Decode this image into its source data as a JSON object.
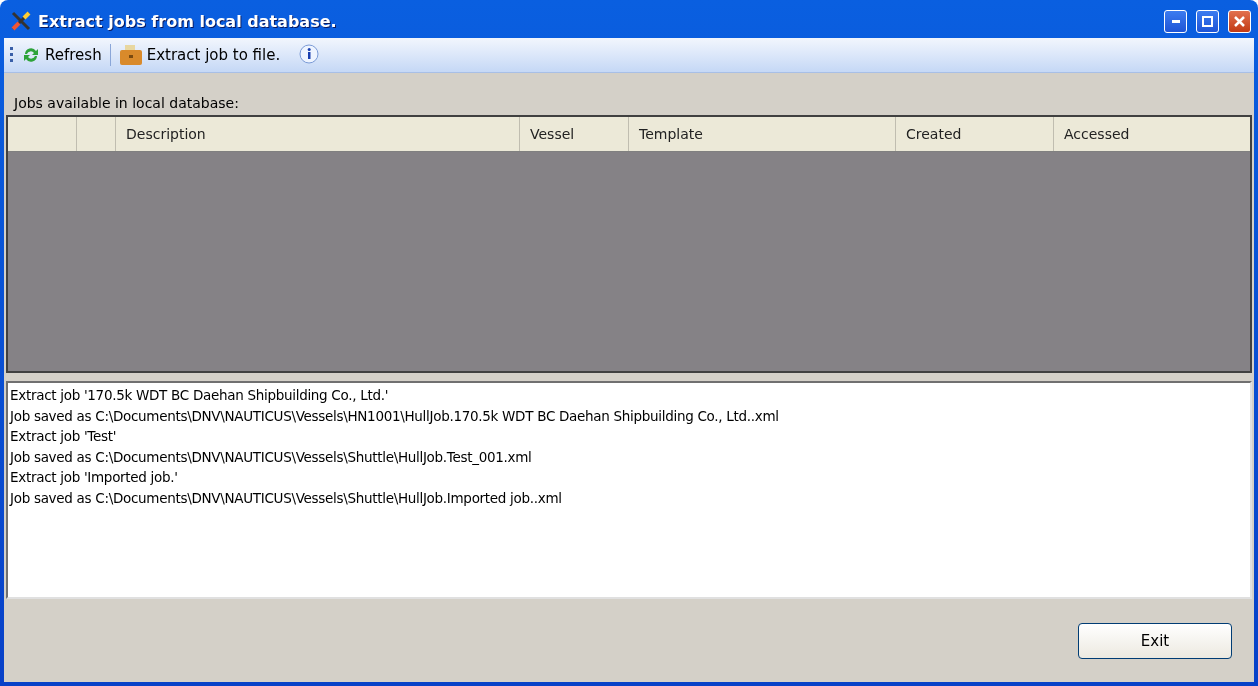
{
  "window": {
    "title": "Extract jobs from local database."
  },
  "toolbar": [
    {
      "kind": "refresh",
      "label": "Refresh"
    },
    {
      "kind": "extract",
      "label": "Extract job to file."
    },
    {
      "kind": "info"
    }
  ],
  "jobs_label": "Jobs available in local database:",
  "table": {
    "columns": [
      "Description",
      "Vessel",
      "Template",
      "Created",
      "Accessed"
    ]
  },
  "log": [
    "Extract job '170.5k WDT BC Daehan Shipbuilding Co., Ltd.'",
    "Job saved as C:\\Documents\\DNV\\NAUTICUS\\Vessels\\HN1001\\HullJob.170.5k WDT BC Daehan Shipbuilding Co., Ltd..xml",
    "Extract job 'Test'",
    "Job saved as C:\\Documents\\DNV\\NAUTICUS\\Vessels\\Shuttle\\HullJob.Test_001.xml",
    "Extract job 'Imported job.'",
    "Job saved as C:\\Documents\\DNV\\NAUTICUS\\Vessels\\Shuttle\\HullJob.Imported job..xml"
  ],
  "buttons": [
    "Exit"
  ]
}
